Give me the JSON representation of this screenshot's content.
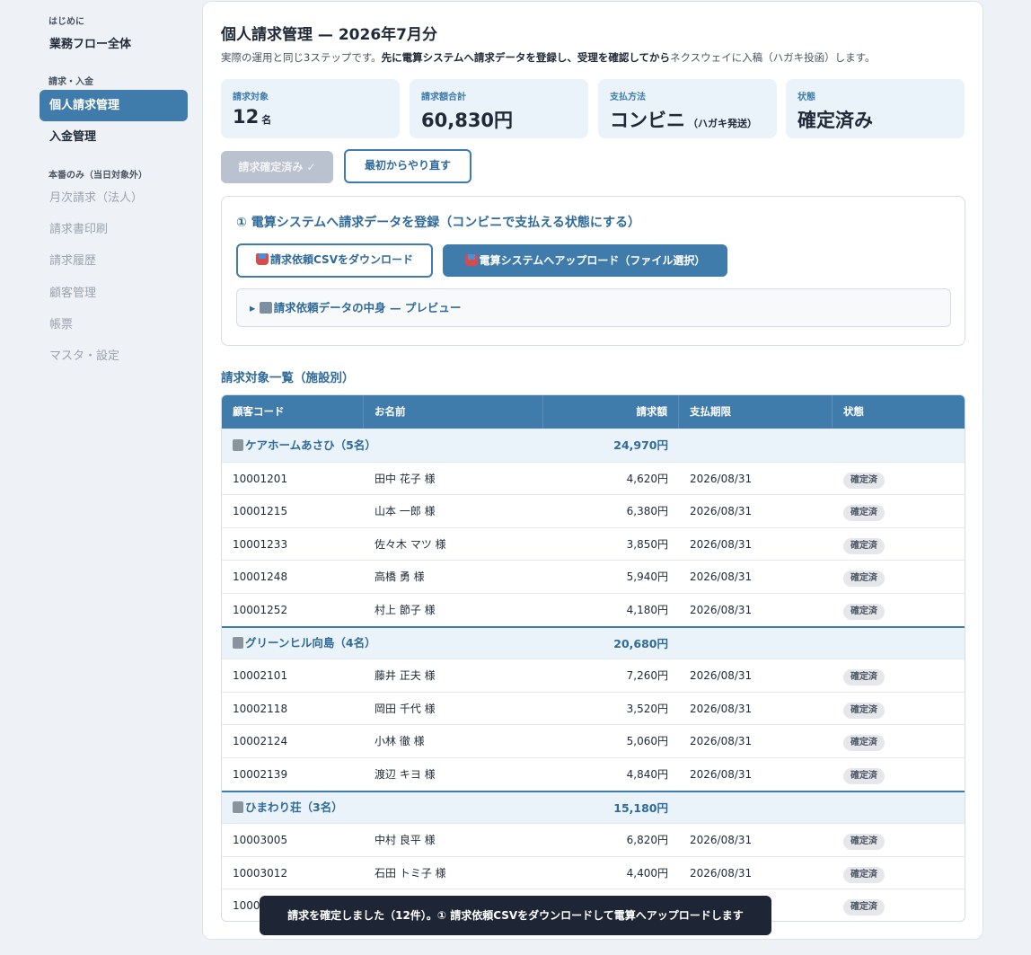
{
  "sidebar": {
    "groups": [
      {
        "label": "はじめに",
        "items": [
          {
            "label": "業務フロー全体"
          }
        ]
      },
      {
        "label": "請求・入金",
        "items": [
          {
            "label": "個人請求管理"
          },
          {
            "label": "入金管理"
          }
        ]
      },
      {
        "label": "本番のみ（当日対象外）",
        "items": [
          {
            "label": "月次請求（法人）"
          },
          {
            "label": "請求書印刷"
          },
          {
            "label": "請求履歴"
          },
          {
            "label": "顧客管理"
          },
          {
            "label": "帳票"
          },
          {
            "label": "マスタ・設定"
          }
        ]
      }
    ]
  },
  "header": {
    "title": "個人請求管理 — 2026年7月分",
    "desc_prefix": "実際の運用と同じ3ステップです。",
    "desc_bold": "先に電算システムへ請求データを登録し、受理を確認してから",
    "desc_suffix": "ネクスウェイに入稿（ハガキ投函）します。"
  },
  "stats": [
    {
      "label": "請求対象",
      "value": "12",
      "unit": "名"
    },
    {
      "label": "請求額合計",
      "value": "60,830円",
      "unit": ""
    },
    {
      "label": "支払方法",
      "value": "コンビニ",
      "unit": "（ハガキ発送）"
    },
    {
      "label": "状態",
      "value": "確定済み",
      "unit": ""
    }
  ],
  "actions": {
    "confirmed_label": "請求確定済み ✓",
    "reset_label": "最初からやり直す"
  },
  "step1": {
    "title": "① 電算システムへ請求データを登録（コンビニで支払える状態にする）",
    "download_label": "請求依頼CSVをダウンロード",
    "upload_label": "電算システムへアップロード（ファイル選択）",
    "preview_label": "請求依頼データの中身 — プレビュー"
  },
  "list": {
    "title": "請求対象一覧（施設別）",
    "columns": [
      "顧客コード",
      "お名前",
      "請求額",
      "支払期限",
      "状態"
    ],
    "groups": [
      {
        "name": "ケアホームあさひ（5名）",
        "total": "24,970円",
        "rows": [
          {
            "code": "10001201",
            "name": "田中 花子 様",
            "amount": "4,620円",
            "due": "2026/08/31",
            "status": "確定済"
          },
          {
            "code": "10001215",
            "name": "山本 一郎 様",
            "amount": "6,380円",
            "due": "2026/08/31",
            "status": "確定済"
          },
          {
            "code": "10001233",
            "name": "佐々木 マツ 様",
            "amount": "3,850円",
            "due": "2026/08/31",
            "status": "確定済"
          },
          {
            "code": "10001248",
            "name": "高橋 勇 様",
            "amount": "5,940円",
            "due": "2026/08/31",
            "status": "確定済"
          },
          {
            "code": "10001252",
            "name": "村上 節子 様",
            "amount": "4,180円",
            "due": "2026/08/31",
            "status": "確定済"
          }
        ]
      },
      {
        "name": "グリーンヒル向島（4名）",
        "total": "20,680円",
        "rows": [
          {
            "code": "10002101",
            "name": "藤井 正夫 様",
            "amount": "7,260円",
            "due": "2026/08/31",
            "status": "確定済"
          },
          {
            "code": "10002118",
            "name": "岡田 千代 様",
            "amount": "3,520円",
            "due": "2026/08/31",
            "status": "確定済"
          },
          {
            "code": "10002124",
            "name": "小林 徹 様",
            "amount": "5,060円",
            "due": "2026/08/31",
            "status": "確定済"
          },
          {
            "code": "10002139",
            "name": "渡辺 キヨ 様",
            "amount": "4,840円",
            "due": "2026/08/31",
            "status": "確定済"
          }
        ]
      },
      {
        "name": "ひまわり荘（3名）",
        "total": "15,180円",
        "rows": [
          {
            "code": "10003005",
            "name": "中村 良平 様",
            "amount": "6,820円",
            "due": "2026/08/31",
            "status": "確定済"
          },
          {
            "code": "10003012",
            "name": "石田 トミ子 様",
            "amount": "4,400円",
            "due": "2026/08/31",
            "status": "確定済"
          },
          {
            "code": "1000",
            "name": "",
            "amount": "",
            "due": "",
            "status": "確定済"
          }
        ]
      }
    ]
  },
  "toast": {
    "message": "請求を確定しました（12件）。① 請求依頼CSVをダウンロードして電算へアップロードします"
  }
}
